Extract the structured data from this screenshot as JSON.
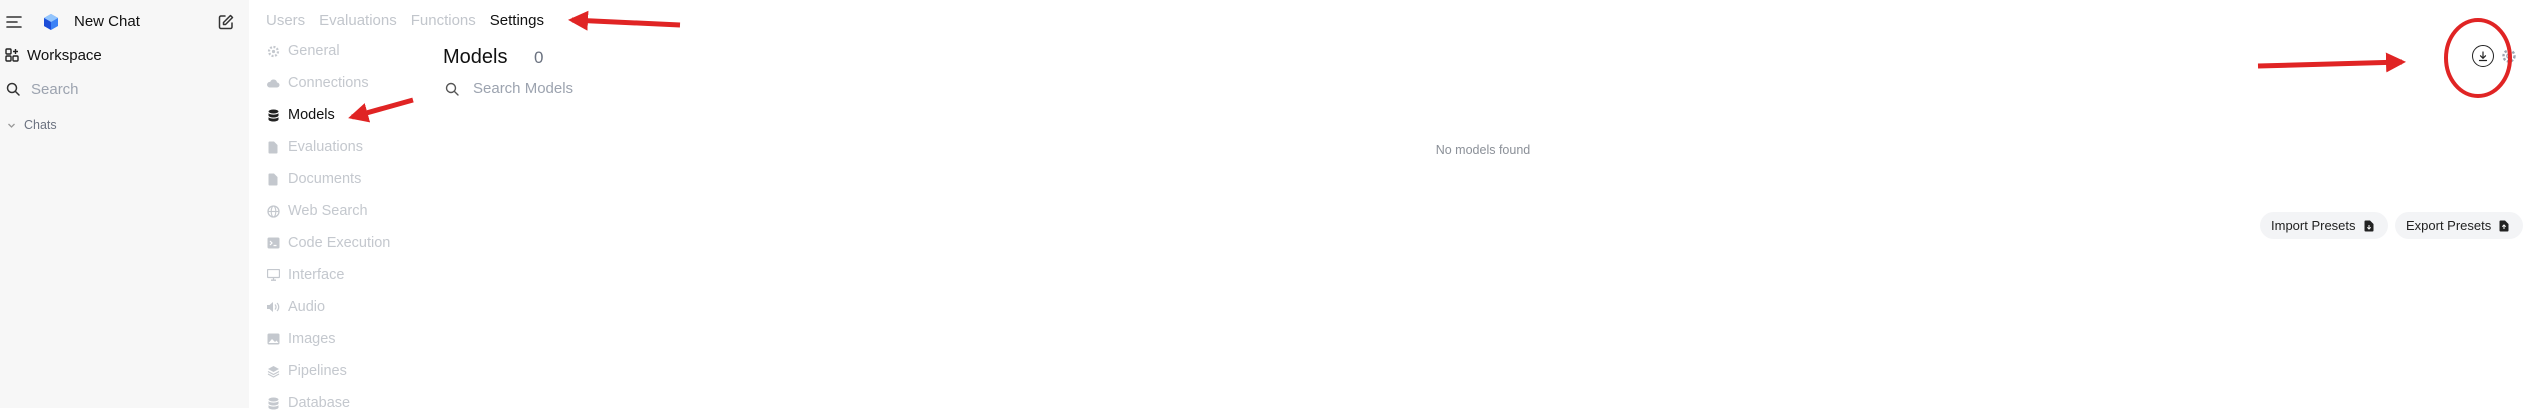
{
  "sidebar": {
    "new_chat_label": "New Chat",
    "workspace_label": "Workspace",
    "search_label": "Search",
    "chats_label": "Chats"
  },
  "tabs": [
    {
      "label": "Users",
      "active": false
    },
    {
      "label": "Evaluations",
      "active": false
    },
    {
      "label": "Functions",
      "active": false
    },
    {
      "label": "Settings",
      "active": true
    }
  ],
  "settings_nav": [
    {
      "label": "General",
      "icon": "gear-icon"
    },
    {
      "label": "Connections",
      "icon": "cloud-icon"
    },
    {
      "label": "Models",
      "icon": "database-icon",
      "active": true
    },
    {
      "label": "Evaluations",
      "icon": "document-icon"
    },
    {
      "label": "Documents",
      "icon": "document-icon"
    },
    {
      "label": "Web Search",
      "icon": "globe-icon"
    },
    {
      "label": "Code Execution",
      "icon": "terminal-icon"
    },
    {
      "label": "Interface",
      "icon": "monitor-icon"
    },
    {
      "label": "Audio",
      "icon": "speaker-icon"
    },
    {
      "label": "Images",
      "icon": "image-icon"
    },
    {
      "label": "Pipelines",
      "icon": "stack-icon"
    },
    {
      "label": "Database",
      "icon": "database-icon"
    }
  ],
  "main": {
    "title": "Models",
    "count": "0",
    "search_placeholder": "Search Models",
    "empty_message": "No models found",
    "import_label": "Import Presets",
    "export_label": "Export Presets"
  },
  "colors": {
    "annotation_red": "#e02424",
    "sidebar_bg": "#f7f7f7",
    "muted_text": "#c4c8ce"
  }
}
